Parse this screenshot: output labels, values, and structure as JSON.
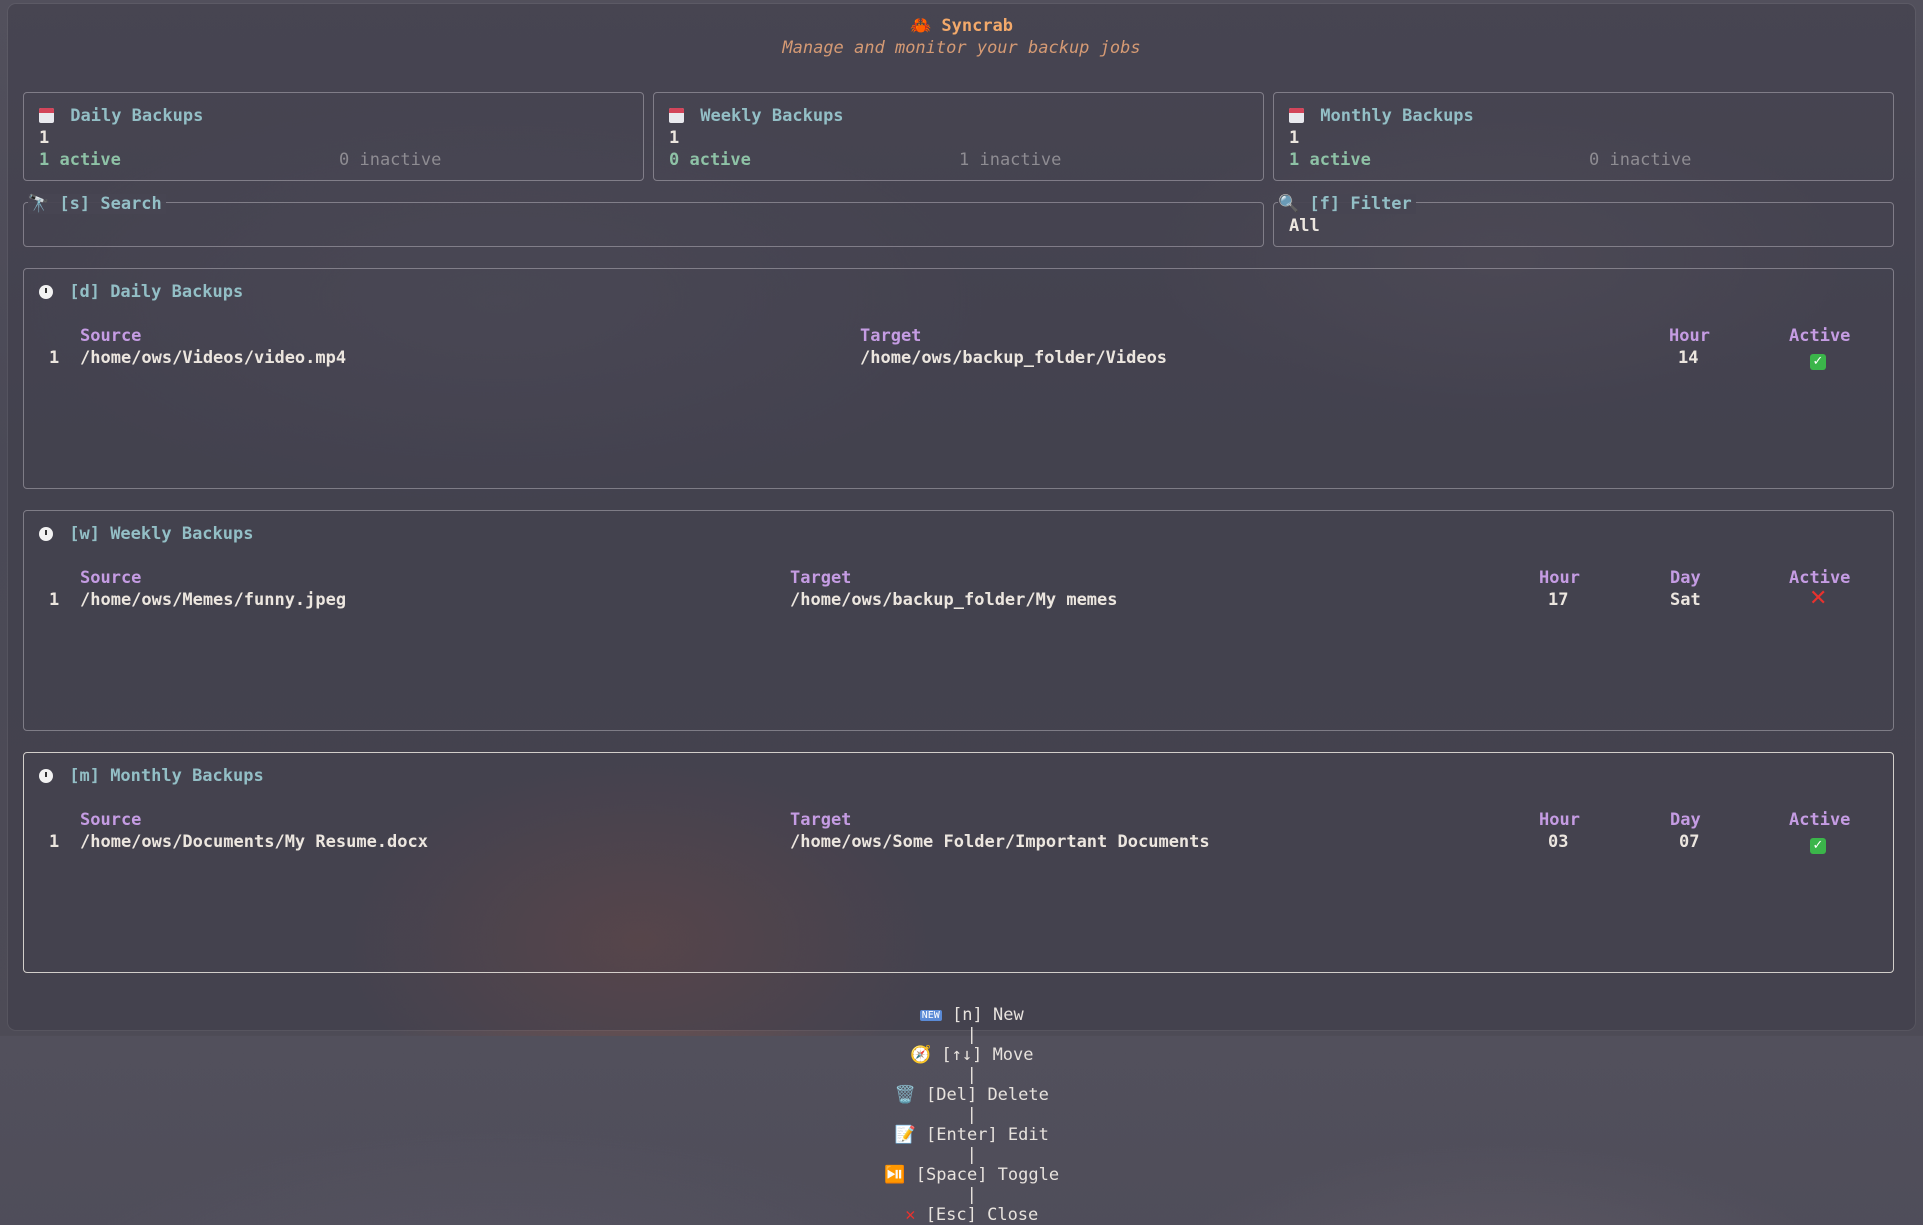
{
  "app": {
    "icon": "crab-icon",
    "title": "Syncrab",
    "subtitle": "Manage and monitor your backup jobs"
  },
  "summary": {
    "daily": {
      "label": "Daily Backups",
      "count": "1",
      "active": "1 active",
      "inactive": "0 inactive"
    },
    "weekly": {
      "label": "Weekly Backups",
      "count": "1",
      "active": "0 active",
      "inactive": "1 inactive"
    },
    "monthly": {
      "label": "Monthly Backups",
      "count": "1",
      "active": "1 active",
      "inactive": "0 inactive"
    }
  },
  "search": {
    "label": "[s] Search",
    "value": ""
  },
  "filter": {
    "label": "[f] Filter",
    "value": "All"
  },
  "daily_table": {
    "title": "[d] Daily Backups",
    "headers": {
      "source": "Source",
      "target": "Target",
      "hour": "Hour",
      "active": "Active"
    },
    "rows": [
      {
        "index": "1",
        "source": "/home/ows/Videos/video.mp4",
        "target": "/home/ows/backup_folder/Videos",
        "hour": "14",
        "active": true
      }
    ]
  },
  "weekly_table": {
    "title": "[w] Weekly Backups",
    "headers": {
      "source": "Source",
      "target": "Target",
      "hour": "Hour",
      "day": "Day",
      "active": "Active"
    },
    "rows": [
      {
        "index": "1",
        "source": "/home/ows/Memes/funny.jpeg",
        "target": "/home/ows/backup_folder/My memes",
        "hour": "17",
        "day": "Sat",
        "active": false
      }
    ]
  },
  "monthly_table": {
    "title": "[m] Monthly Backups",
    "headers": {
      "source": "Source",
      "target": "Target",
      "hour": "Hour",
      "day": "Day",
      "active": "Active"
    },
    "rows": [
      {
        "index": "1",
        "source": "/home/ows/Documents/My Resume.docx",
        "target": "/home/ows/Some Folder/Important Documents",
        "hour": "03",
        "day": "07",
        "active": true
      }
    ]
  },
  "footer": {
    "new": "[n] New",
    "move": "[↑↓] Move",
    "delete": "[Del] Delete",
    "edit": "[Enter] Edit",
    "toggle": "[Space] Toggle",
    "close": "[Esc] Close",
    "sep": "|"
  },
  "colors": {
    "accent_orange": "#f3a96a",
    "header_purple": "#c59ce3",
    "label_cyan": "#93bfc6",
    "active_green": "#8ec2a6"
  }
}
